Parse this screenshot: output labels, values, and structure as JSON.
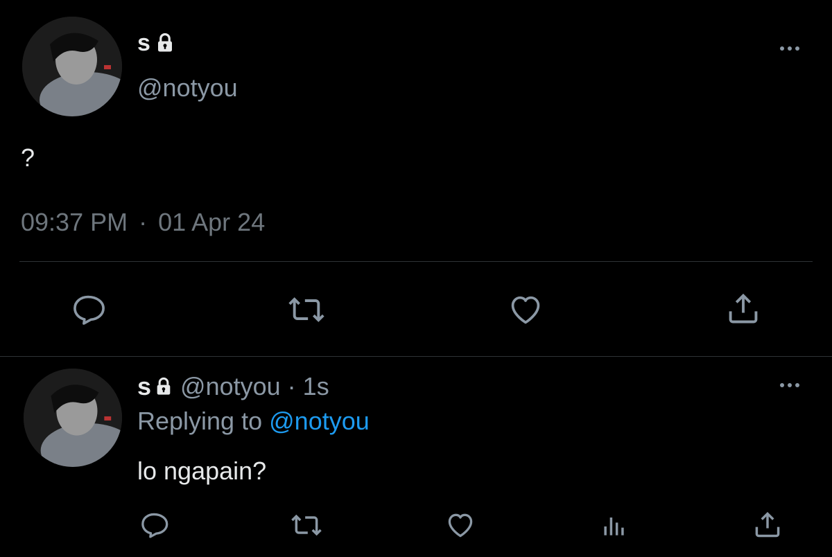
{
  "main_tweet": {
    "display_name": "s",
    "handle": "@notyou",
    "text": "?",
    "time": "09:37 PM",
    "separator": "·",
    "date": "01 Apr 24"
  },
  "reply_tweet": {
    "display_name": "s",
    "handle": "@notyou",
    "separator": "·",
    "age": "1s",
    "replying_prefix": "Replying to",
    "replying_to": "@notyou",
    "text": "lo ngapain?"
  },
  "icons": {
    "lock": "lock-icon",
    "more": "more-icon",
    "reply": "reply-icon",
    "retweet": "retweet-icon",
    "like": "heart-icon",
    "views": "analytics-icon",
    "share": "share-icon"
  },
  "colors": {
    "background": "#000000",
    "text": "#e7e9ea",
    "secondary": "#8b98a5",
    "link": "#1d9bf0",
    "divider": "#2f3336"
  }
}
